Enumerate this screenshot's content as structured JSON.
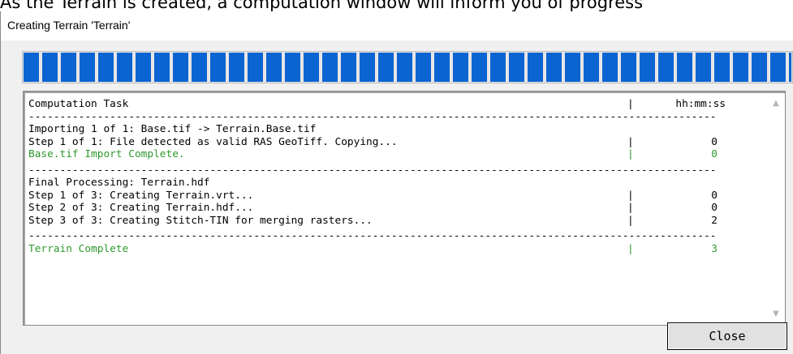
{
  "page_caption": "As the Terrain is created, a computation window will inform you of progress",
  "window": {
    "title": "Creating Terrain 'Terrain'"
  },
  "progress": {
    "fraction": 1.0
  },
  "log": {
    "header": {
      "task": "Computation Task",
      "pipe": "|",
      "time": "hh:mm:ss"
    },
    "separator": "------------------------------------------------------------------------------------------------------------------------------------------------------------",
    "sections": [
      {
        "lines": [
          {
            "task": "Importing 1 of 1: Base.tif -> Terrain.Base.tif",
            "pipe": "",
            "time": "",
            "status": "normal"
          },
          {
            "task": "Step 1 of 1: File detected as valid RAS GeoTiff. Copying...",
            "pipe": "|",
            "time": "0",
            "status": "normal"
          },
          {
            "task": "Base.tif Import Complete.",
            "pipe": "|",
            "time": "0",
            "status": "complete"
          }
        ]
      },
      {
        "lines": [
          {
            "task": "Final Processing: Terrain.hdf",
            "pipe": "",
            "time": "",
            "status": "normal"
          },
          {
            "task": "Step 1 of 3: Creating Terrain.vrt...",
            "pipe": "|",
            "time": "0",
            "status": "normal"
          },
          {
            "task": "Step 2 of 3: Creating Terrain.hdf...",
            "pipe": "|",
            "time": "0",
            "status": "normal"
          },
          {
            "task": "Step 3 of 3: Creating Stitch-TIN for merging rasters...",
            "pipe": "|",
            "time": "2",
            "status": "normal"
          }
        ]
      },
      {
        "lines": [
          {
            "task": "Terrain Complete",
            "pipe": "|",
            "time": "3",
            "status": "complete"
          }
        ]
      }
    ]
  },
  "buttons": {
    "close_label": "Close"
  },
  "icons": {
    "scroll_up": "chevron-up-icon",
    "scroll_down": "chevron-down-icon"
  },
  "colors": {
    "progress": "#0a64d2",
    "complete_text": "#2e9a2e"
  }
}
